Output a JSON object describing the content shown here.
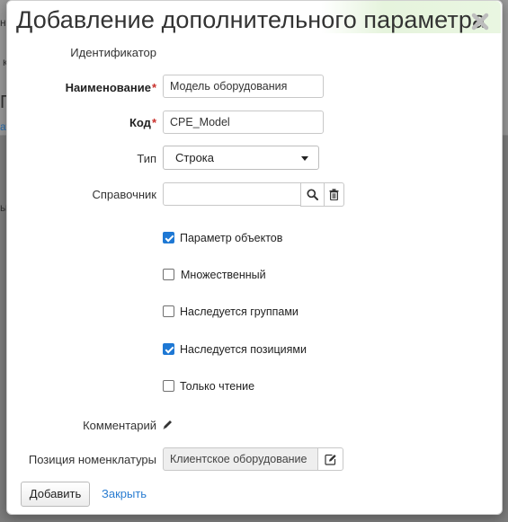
{
  "background": {
    "fragments": [
      "на",
      "к",
      "П",
      "ать",
      "ы"
    ]
  },
  "dialog": {
    "title": "Добавление дополнительного параметра",
    "accent_tint": "#e9f6e1"
  },
  "form": {
    "identifier_label": "Идентификатор",
    "name_label": "Наименование",
    "name_value": "Модель оборудования",
    "code_label": "Код",
    "code_value": "CPE_Model",
    "required_mark": "*",
    "type_label": "Тип",
    "type_value": "Строка",
    "reference_label": "Справочник",
    "reference_value": "",
    "checkboxes": [
      {
        "label": "Параметр объектов",
        "checked": true
      },
      {
        "label": "Множественный",
        "checked": false
      },
      {
        "label": "Наследуется группами",
        "checked": false
      },
      {
        "label": "Наследуется позициями",
        "checked": true
      },
      {
        "label": "Только чтение",
        "checked": false
      }
    ],
    "comment_label": "Комментарий",
    "nomenclature_label": "Позиция номенклатуры",
    "nomenclature_value": "Клиентское оборудование"
  },
  "footer": {
    "add_label": "Добавить",
    "close_label": "Закрыть"
  },
  "colors": {
    "checkbox_checked": "#1e78d4",
    "required": "#c9302c",
    "link": "#2a7dd1"
  }
}
